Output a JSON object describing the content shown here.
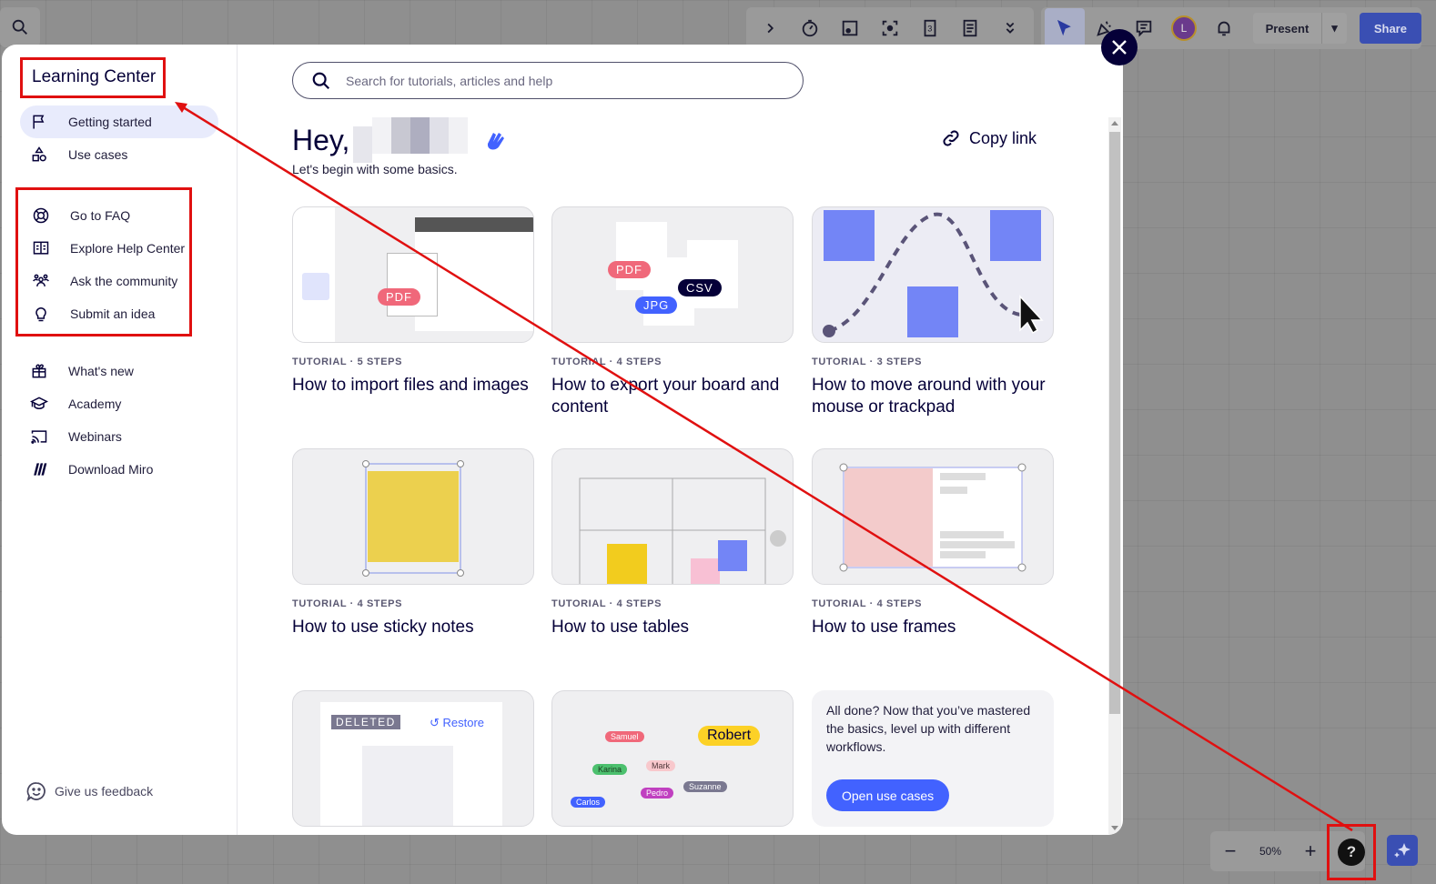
{
  "toolbar": {
    "search_icon": "search-icon",
    "tools": [
      "chevron-right-icon",
      "timer-icon",
      "card-icon",
      "focus-icon",
      "count-icon",
      "notes-icon",
      "more-icon"
    ],
    "collab": [
      "cursor-icon",
      "celebrate-icon",
      "comment-icon"
    ],
    "avatar_initial": "L",
    "present_label": "Present",
    "share_label": "Share"
  },
  "sidebar": {
    "title": "Learning Center",
    "primary": [
      {
        "label": "Getting started",
        "icon": "flag-icon",
        "active": true
      },
      {
        "label": "Use cases",
        "icon": "shapes-icon"
      }
    ],
    "help": [
      {
        "label": "Go to FAQ",
        "icon": "lifebuoy-icon"
      },
      {
        "label": "Explore Help Center",
        "icon": "book-icon"
      },
      {
        "label": "Ask the community",
        "icon": "community-icon"
      },
      {
        "label": "Submit an idea",
        "icon": "bulb-icon"
      }
    ],
    "resources": [
      {
        "label": "What's new",
        "icon": "gift-icon"
      },
      {
        "label": "Academy",
        "icon": "graduation-icon"
      },
      {
        "label": "Webinars",
        "icon": "cast-icon"
      },
      {
        "label": "Download Miro",
        "icon": "miro-icon"
      }
    ],
    "feedback": "Give us feedback"
  },
  "main": {
    "search_placeholder": "Search for tutorials, articles and help",
    "greeting": "Hey,",
    "subtitle": "Let's begin with some basics.",
    "copy_link": "Copy link",
    "cards": [
      {
        "meta": "TUTORIAL · 5 STEPS",
        "title": "How to import files and images"
      },
      {
        "meta": "TUTORIAL · 4 STEPS",
        "title": "How to export your board and content"
      },
      {
        "meta": "TUTORIAL · 3 STEPS",
        "title": "How to move around with your mouse or trackpad"
      },
      {
        "meta": "TUTORIAL · 4 STEPS",
        "title": "How to use sticky notes"
      },
      {
        "meta": "TUTORIAL · 4 STEPS",
        "title": "How to use tables"
      },
      {
        "meta": "TUTORIAL · 4 STEPS",
        "title": "How to use frames"
      }
    ],
    "thumb_labels": {
      "pdf": "PDF",
      "jpg": "JPG",
      "csv": "CSV",
      "deleted": "DELETED",
      "restore": "Restore",
      "names": [
        "Samuel",
        "Karina",
        "Mark",
        "Carlos",
        "Pedro",
        "Suzanne",
        "Robert"
      ]
    },
    "cta": {
      "text": "All done? Now that you’ve mastered the basics, level up with different workflows.",
      "button": "Open use cases"
    }
  },
  "zoom": {
    "minus": "−",
    "value": "50%",
    "plus": "+"
  },
  "help_button": "?",
  "colors": {
    "accent": "#4262ff",
    "dark": "#050038",
    "annotation": "#e01010"
  }
}
